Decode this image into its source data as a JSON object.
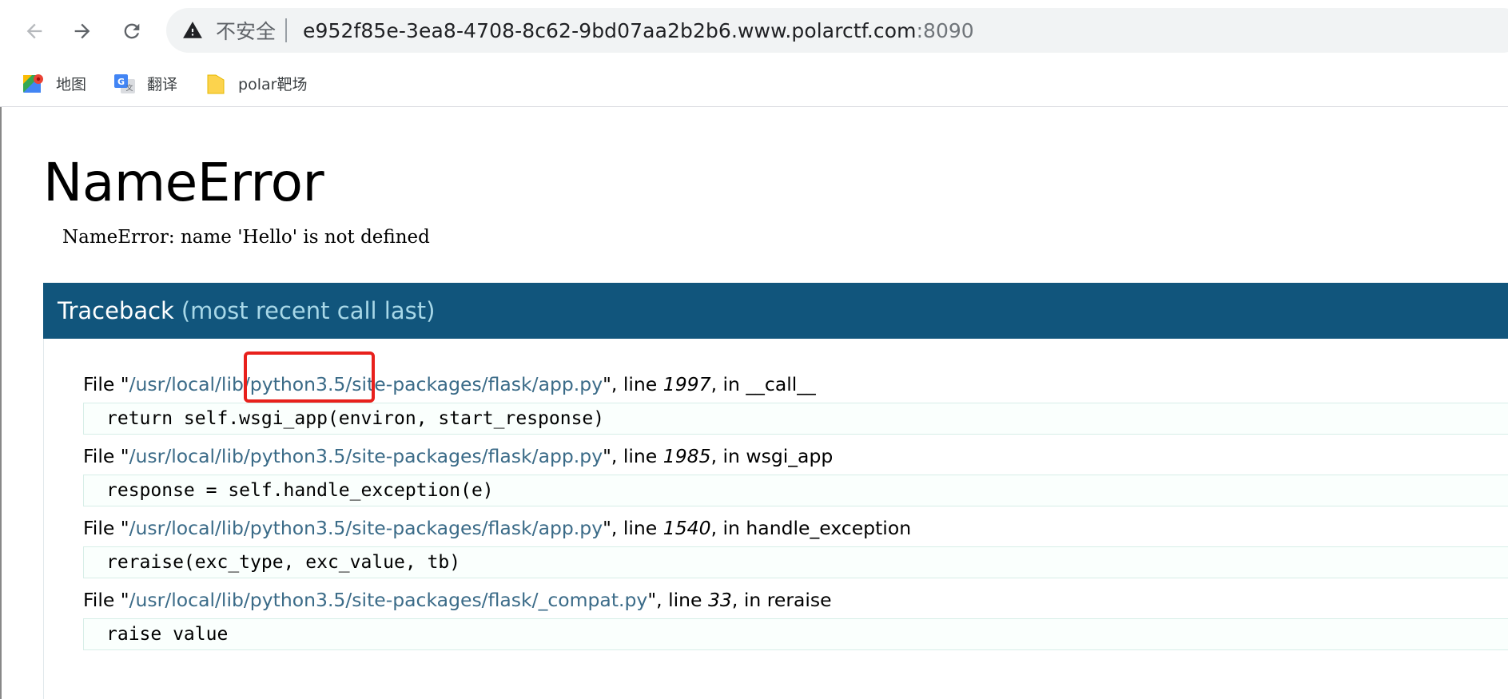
{
  "browser": {
    "security_label": "不安全",
    "url_host": "e952f85e-3ea8-4708-8c62-9bd07aa2b2b6.www.polarctf.com",
    "url_port": ":8090",
    "bookmarks": [
      {
        "label": "地图",
        "icon": "maps-icon"
      },
      {
        "label": "翻译",
        "icon": "translate-icon"
      },
      {
        "label": "polar靶场",
        "icon": "folder-icon"
      }
    ]
  },
  "page": {
    "title": "NameError",
    "message": "NameError: name 'Hello' is not defined",
    "traceback_title": "Traceback",
    "traceback_subtitle": "(most recent call last)",
    "frames": [
      {
        "prefix": "File \"",
        "path": "/usr/local/lib/python3.5/site-packages/flask/app.py",
        "mid": "\", line ",
        "line": "1997",
        "suffix": ", in __call__",
        "code": "return self.wsgi_app(environ, start_response)"
      },
      {
        "prefix": "File \"",
        "path": "/usr/local/lib/python3.5/site-packages/flask/app.py",
        "mid": "\", line ",
        "line": "1985",
        "suffix": ", in wsgi_app",
        "code": "response = self.handle_exception(e)"
      },
      {
        "prefix": "File \"",
        "path": "/usr/local/lib/python3.5/site-packages/flask/app.py",
        "mid": "\", line ",
        "line": "1540",
        "suffix": ", in handle_exception",
        "code": "reraise(exc_type, exc_value, tb)"
      },
      {
        "prefix": "File \"",
        "path": "/usr/local/lib/python3.5/site-packages/flask/_compat.py",
        "mid": "\", line ",
        "line": "33",
        "suffix": ", in reraise",
        "code": "raise value"
      }
    ]
  },
  "colors": {
    "traceback_header": "#11557c",
    "path_text": "#3b6b88",
    "annotation": "#e8201c"
  }
}
